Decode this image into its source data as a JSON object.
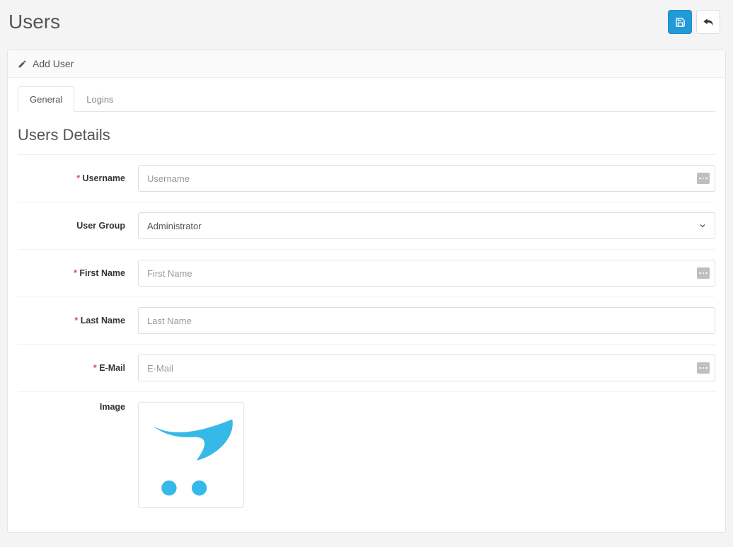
{
  "header": {
    "title": "Users"
  },
  "panel": {
    "heading": "Add User"
  },
  "tabs": [
    {
      "label": "General",
      "active": true
    },
    {
      "label": "Logins",
      "active": false
    }
  ],
  "section": {
    "title": "Users Details"
  },
  "fields": {
    "username": {
      "label": "Username",
      "placeholder": "Username",
      "value": ""
    },
    "user_group": {
      "label": "User Group",
      "selected": "Administrator"
    },
    "first_name": {
      "label": "First Name",
      "placeholder": "First Name",
      "value": ""
    },
    "last_name": {
      "label": "Last Name",
      "placeholder": "Last Name",
      "value": ""
    },
    "email": {
      "label": "E-Mail",
      "placeholder": "E-Mail",
      "value": ""
    },
    "image": {
      "label": "Image"
    }
  },
  "colors": {
    "accent": "#229ad6",
    "cart_blue": "#36b9e8",
    "required": "#d9534f"
  }
}
